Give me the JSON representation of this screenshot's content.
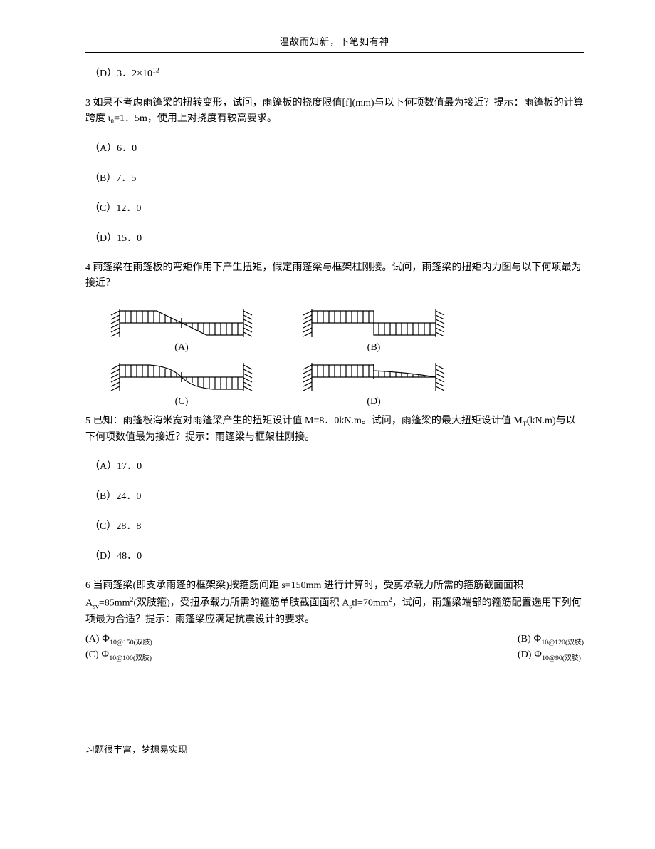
{
  "header": "温故而知新，下笔如有神",
  "d_prev": "（D）3．2×10",
  "d_prev_sup": "12",
  "q3_text": "3 如果不考虑雨篷梁的扭转变形，试问，雨篷板的挠度限值[f](mm)与以下何项数值最为接近？提示：雨篷板的计算跨度 ι₀=1．5m，使用上对挠度有较高要求。",
  "q3_a": "（A）6．0",
  "q3_b": "（B）7．5",
  "q3_c": "（C）12．0",
  "q3_d": "（D）15．0",
  "q4_text": "4 雨篷梁在雨篷板的弯矩作用下产生扭矩，假定雨篷梁与框架柱刚接。试问，雨篷梁的扭矩内力图与以下何项最为接近？",
  "labelA": "(A)",
  "labelB": "(B)",
  "labelC": "(C)",
  "labelD": "(D)",
  "q5_text": "5 已知：雨篷板海米宽对雨篷梁产生的扭矩设计值 M=8．0kN.m。试问，雨篷梁的最大扭矩设计值 M",
  "q5_sub": "T",
  "q5_text2": "(kN.m)与以下何项数值最为接近？提示：雨篷梁与框架柱刚接。",
  "q5_a": "（A）17．0",
  "q5_b": "（B）24．0",
  "q5_c": "（C）28．8",
  "q5_d": "（D）48．0",
  "q6_text1": "6 当雨篷梁(即支承雨篷的框架梁)按箍筋间距 s=150mm 进行计算时，受剪承载力所需的箍筋截面面积 A",
  "q6_sv": "sv",
  "q6_text2": "=85mm",
  "q6_text3": "(双肢箍)，受扭承载力所需的箍筋单肢截面面积 A",
  "q6_st": "s",
  "q6_text4": "tl=70mm",
  "q6_text5": "，试问，雨篷梁端部的箍筋配置选用下列何项最为合适？提示：雨篷梁应满足抗震设计的要求。",
  "q6_a_pre": "(A) ",
  "q6_a_rebar": "10@150(双肢)",
  "q6_b_pre": "(B) ",
  "q6_b_rebar": "10@120(双肢)",
  "q6_c_pre": "(C) ",
  "q6_c_rebar": "10@100(双肢)",
  "q6_d_pre": "(D) ",
  "q6_d_rebar": "10@90(双肢)",
  "footer": "习题很丰富，梦想易实现"
}
